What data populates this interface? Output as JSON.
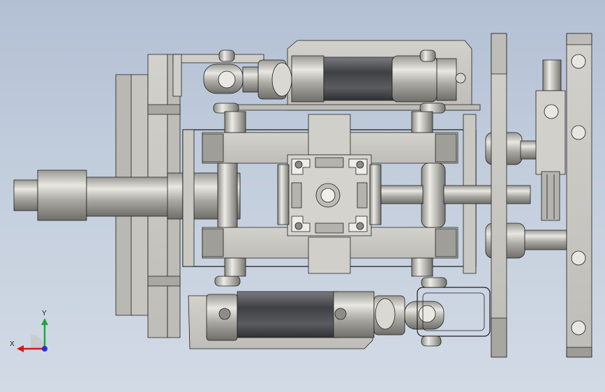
{
  "viewport": {
    "background_top": "#b3c0d4",
    "background_bottom": "#d2dae5"
  },
  "model": {
    "view": "top-view",
    "part_fill": "#c9c8c4",
    "part_shade": "#8e8d89",
    "cylinder_dark": "#55565a",
    "edge_color": "#1e1e1e"
  },
  "triad": {
    "x_label": "X",
    "y_label": "Y",
    "x_color": "#d11a1a",
    "y_color": "#1fa83a",
    "z_color": "#1f33d6"
  }
}
